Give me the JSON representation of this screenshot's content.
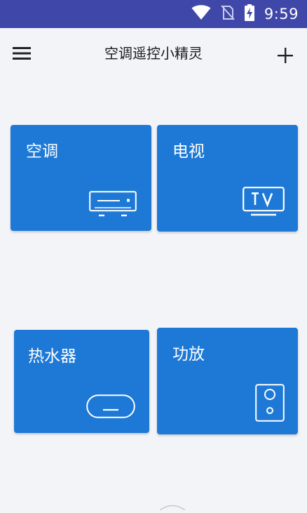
{
  "status_bar": {
    "time": "9:59",
    "icons": [
      "wifi-icon",
      "no-sim-icon",
      "battery-charging-icon"
    ],
    "color": "#3f47a8"
  },
  "toolbar": {
    "title": "空调遥控小精灵",
    "menu_icon": "hamburger-menu-icon",
    "add_icon": "plus-icon"
  },
  "devices": [
    {
      "label": "空调",
      "icon": "air-conditioner-icon"
    },
    {
      "label": "电视",
      "icon": "tv-icon"
    },
    {
      "label": "热水器",
      "icon": "water-heater-icon"
    },
    {
      "label": "功放",
      "icon": "speaker-icon"
    }
  ],
  "colors": {
    "card": "#1e79d6",
    "background": "#f3f4f8"
  }
}
